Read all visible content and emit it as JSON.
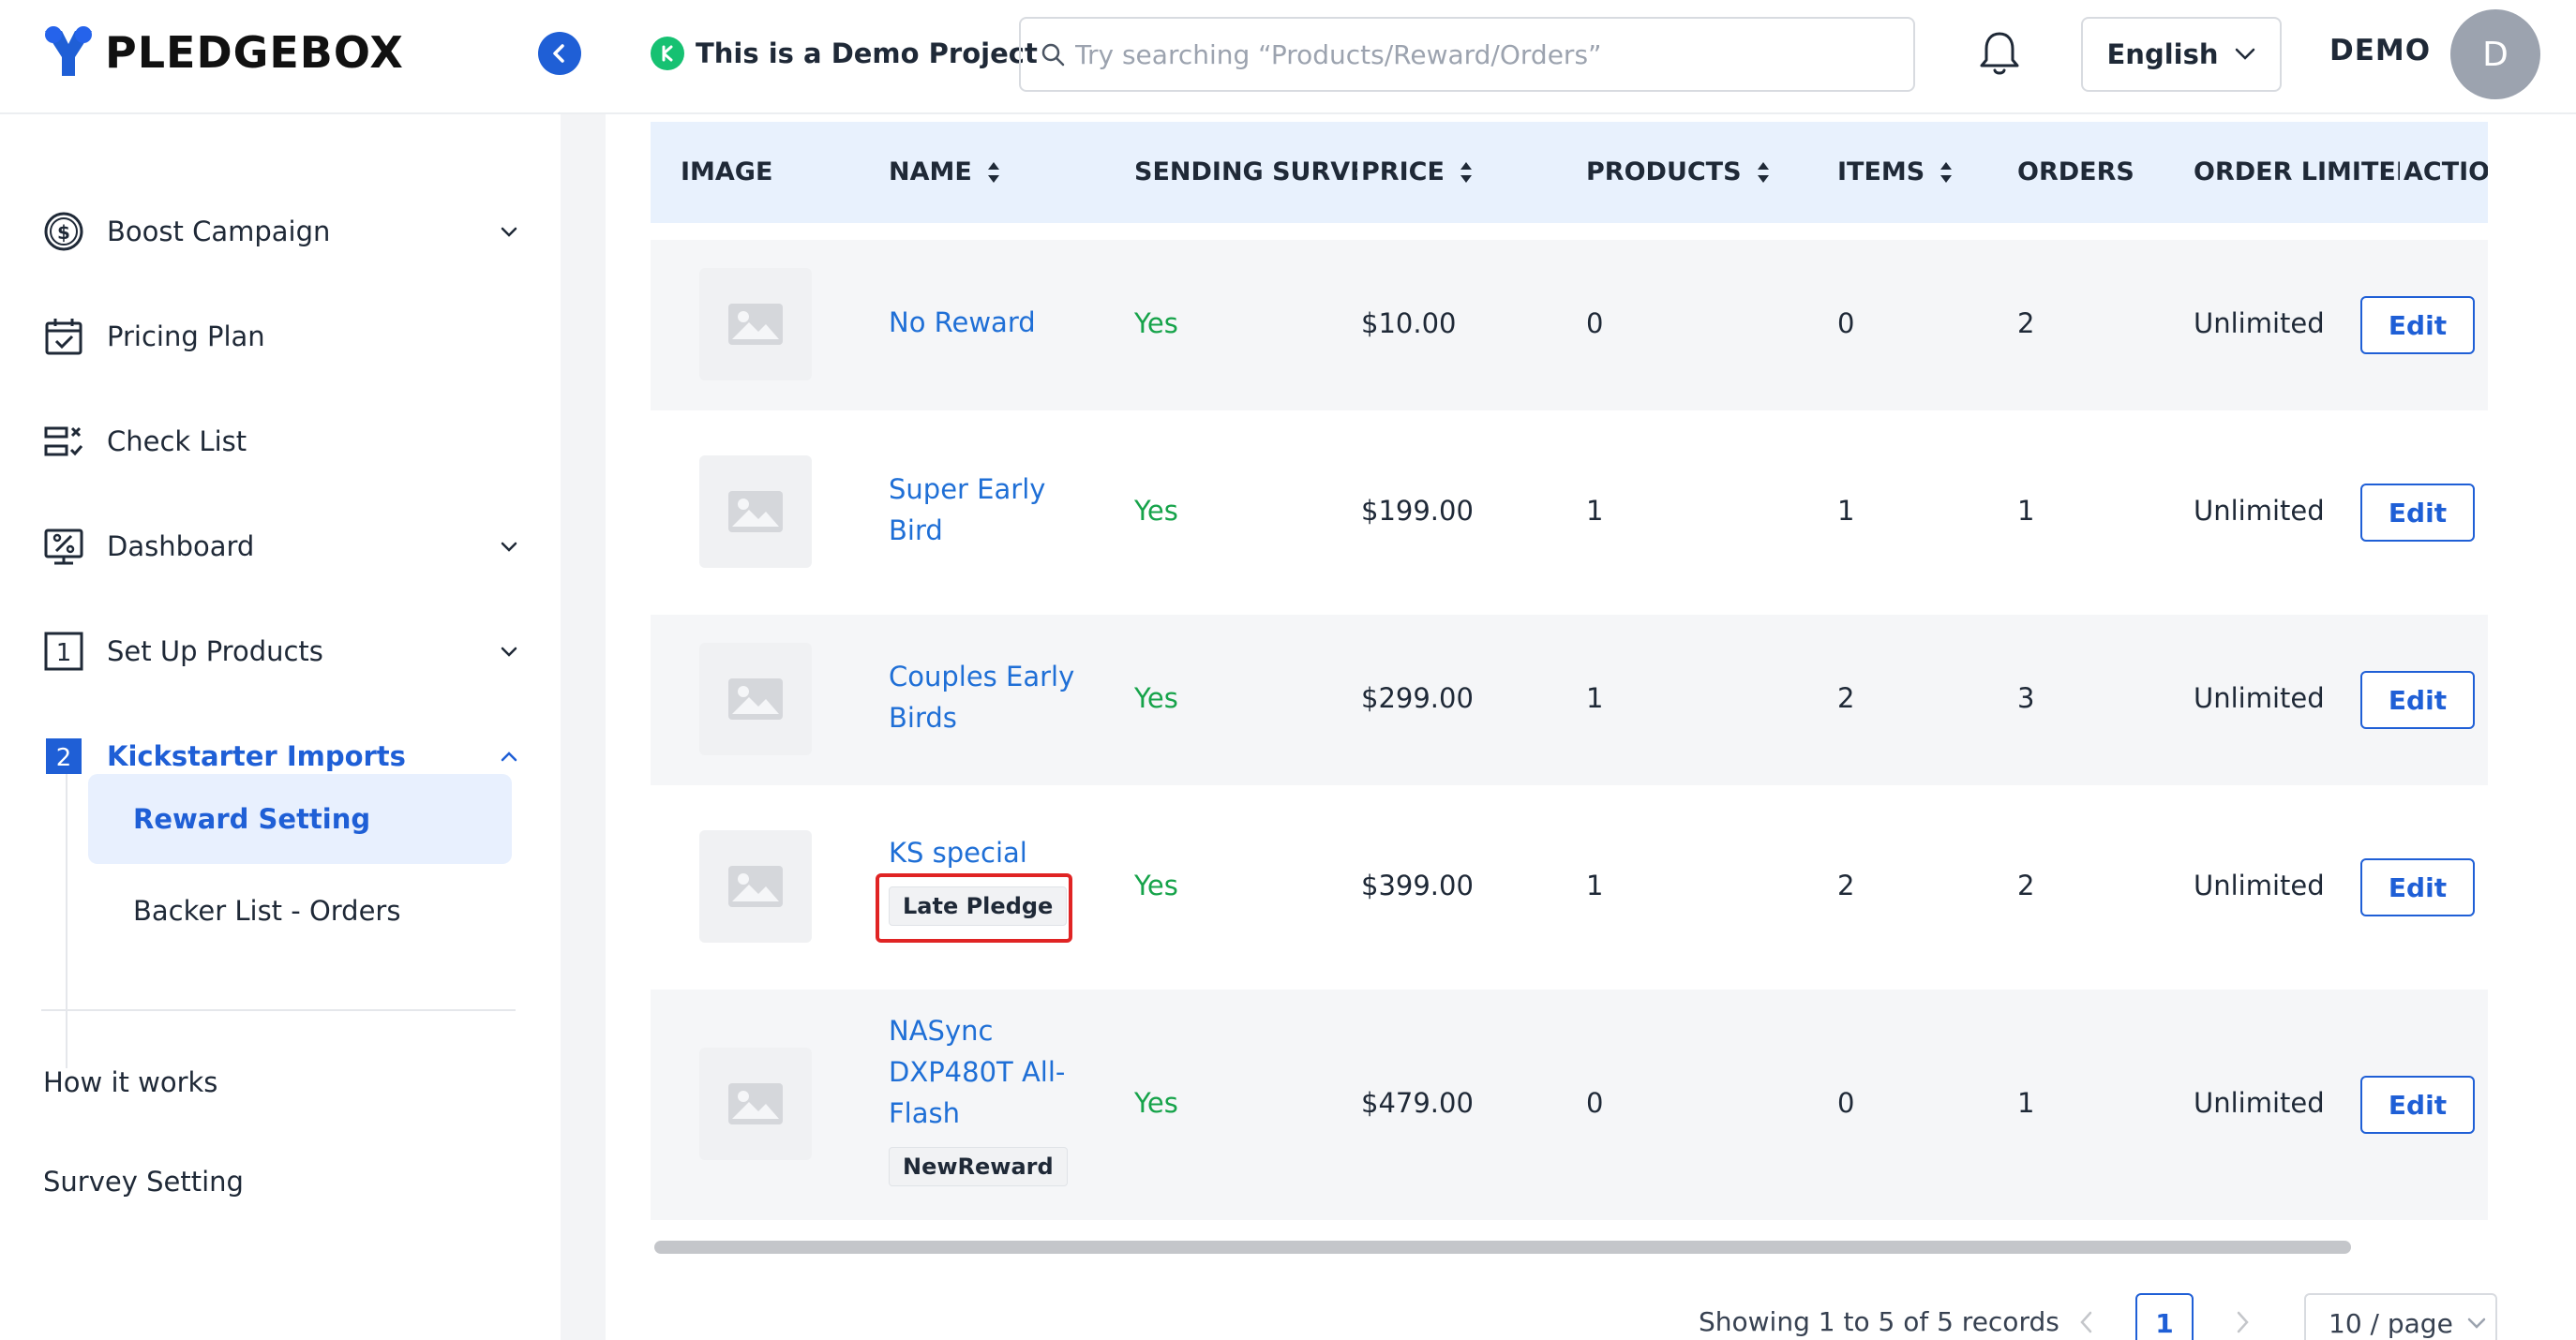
{
  "brand": {
    "name": "PLEDGEBOX"
  },
  "header": {
    "project_label": "This is a Demo Project",
    "search_placeholder": "Try searching “Products/Reward/Orders”",
    "language": "English",
    "user_name": "DEMO",
    "avatar_initial": "D"
  },
  "sidebar": {
    "items": [
      {
        "label": "Boost Campaign",
        "icon": "dollar-circle-icon",
        "has_chevron": true
      },
      {
        "label": "Pricing Plan",
        "icon": "calendar-check-icon",
        "has_chevron": false
      },
      {
        "label": "Check List",
        "icon": "checklist-icon",
        "has_chevron": false
      },
      {
        "label": "Dashboard",
        "icon": "dashboard-percent-icon",
        "has_chevron": true
      },
      {
        "label": "Set Up Products",
        "icon": "step-1-icon",
        "step": "1",
        "has_chevron": true
      },
      {
        "label": "Kickstarter Imports",
        "icon": "step-2-icon",
        "step": "2",
        "has_chevron": true,
        "expanded": true
      }
    ],
    "sub_items": [
      {
        "label": "Reward Setting",
        "active": true
      },
      {
        "label": "Backer List - Orders",
        "active": false
      }
    ],
    "links": [
      {
        "label": "How it works"
      },
      {
        "label": "Survey Setting"
      }
    ]
  },
  "table": {
    "columns": [
      "IMAGE",
      "NAME",
      "SENDING SURVEY",
      "PRICE",
      "PRODUCTS",
      "ITEMS",
      "ORDERS",
      "ORDER LIMITED",
      "ACTION"
    ],
    "sortable": [
      "NAME",
      "PRICE",
      "PRODUCTS",
      "ITEMS"
    ],
    "rows": [
      {
        "name": "No Reward",
        "tag": "",
        "sending_survey": "Yes",
        "price": "$10.00",
        "products": "0",
        "items": "0",
        "orders": "2",
        "order_limited": "Unlimited",
        "action": "Edit"
      },
      {
        "name": "Super Early Bird",
        "tag": "",
        "sending_survey": "Yes",
        "price": "$199.00",
        "products": "1",
        "items": "1",
        "orders": "1",
        "order_limited": "Unlimited",
        "action": "Edit"
      },
      {
        "name": "Couples Early Birds",
        "tag": "",
        "sending_survey": "Yes",
        "price": "$299.00",
        "products": "1",
        "items": "2",
        "orders": "3",
        "order_limited": "Unlimited",
        "action": "Edit"
      },
      {
        "name": "KS special",
        "tag": "Late Pledge",
        "sending_survey": "Yes",
        "price": "$399.00",
        "products": "1",
        "items": "2",
        "orders": "2",
        "order_limited": "Unlimited",
        "action": "Edit"
      },
      {
        "name": "NASync DXP480T All-Flash",
        "tag": "NewReward",
        "sending_survey": "Yes",
        "price": "$479.00",
        "products": "0",
        "items": "0",
        "orders": "1",
        "order_limited": "Unlimited",
        "action": "Edit"
      }
    ]
  },
  "pagination": {
    "summary": "Showing 1 to 5 of 5 records",
    "current_page": "1",
    "page_size": "10 / page"
  },
  "colors": {
    "accent": "#1f5fd6",
    "link": "#1f6fd6",
    "success": "#16a34a",
    "highlight": "#e02424",
    "header_row": "#e8f1fd"
  }
}
